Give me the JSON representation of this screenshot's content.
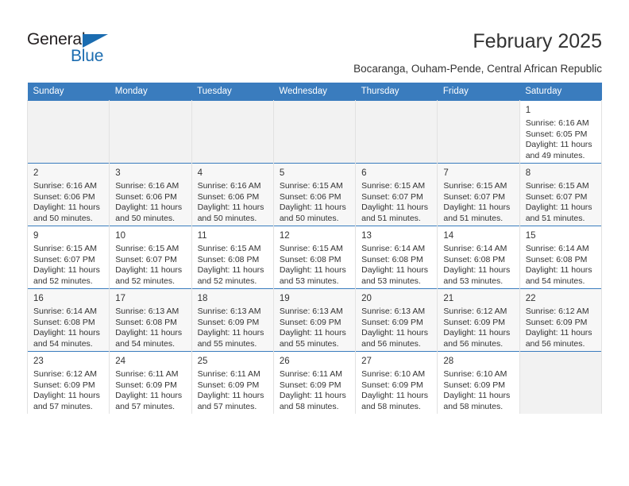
{
  "branding": {
    "logo_primary": "General",
    "logo_secondary": "Blue",
    "logo_icon": "blue-triangle-icon",
    "accent_color": "#1b6cb0"
  },
  "header": {
    "title": "February 2025",
    "subtitle": "Bocaranga, Ouham-Pende, Central African Republic"
  },
  "calendar": {
    "header_background": "#3a7cbe",
    "weekdays": [
      "Sunday",
      "Monday",
      "Tuesday",
      "Wednesday",
      "Thursday",
      "Friday",
      "Saturday"
    ],
    "weeks": [
      [
        {
          "day": "",
          "info": "",
          "empty": true
        },
        {
          "day": "",
          "info": "",
          "empty": true
        },
        {
          "day": "",
          "info": "",
          "empty": true
        },
        {
          "day": "",
          "info": "",
          "empty": true
        },
        {
          "day": "",
          "info": "",
          "empty": true
        },
        {
          "day": "",
          "info": "",
          "empty": true
        },
        {
          "day": "1",
          "info": "Sunrise: 6:16 AM\nSunset: 6:05 PM\nDaylight: 11 hours\nand 49 minutes.",
          "empty": false
        }
      ],
      [
        {
          "day": "2",
          "info": "Sunrise: 6:16 AM\nSunset: 6:06 PM\nDaylight: 11 hours\nand 50 minutes.",
          "empty": false
        },
        {
          "day": "3",
          "info": "Sunrise: 6:16 AM\nSunset: 6:06 PM\nDaylight: 11 hours\nand 50 minutes.",
          "empty": false
        },
        {
          "day": "4",
          "info": "Sunrise: 6:16 AM\nSunset: 6:06 PM\nDaylight: 11 hours\nand 50 minutes.",
          "empty": false
        },
        {
          "day": "5",
          "info": "Sunrise: 6:15 AM\nSunset: 6:06 PM\nDaylight: 11 hours\nand 50 minutes.",
          "empty": false
        },
        {
          "day": "6",
          "info": "Sunrise: 6:15 AM\nSunset: 6:07 PM\nDaylight: 11 hours\nand 51 minutes.",
          "empty": false
        },
        {
          "day": "7",
          "info": "Sunrise: 6:15 AM\nSunset: 6:07 PM\nDaylight: 11 hours\nand 51 minutes.",
          "empty": false
        },
        {
          "day": "8",
          "info": "Sunrise: 6:15 AM\nSunset: 6:07 PM\nDaylight: 11 hours\nand 51 minutes.",
          "empty": false
        }
      ],
      [
        {
          "day": "9",
          "info": "Sunrise: 6:15 AM\nSunset: 6:07 PM\nDaylight: 11 hours\nand 52 minutes.",
          "empty": false
        },
        {
          "day": "10",
          "info": "Sunrise: 6:15 AM\nSunset: 6:07 PM\nDaylight: 11 hours\nand 52 minutes.",
          "empty": false
        },
        {
          "day": "11",
          "info": "Sunrise: 6:15 AM\nSunset: 6:08 PM\nDaylight: 11 hours\nand 52 minutes.",
          "empty": false
        },
        {
          "day": "12",
          "info": "Sunrise: 6:15 AM\nSunset: 6:08 PM\nDaylight: 11 hours\nand 53 minutes.",
          "empty": false
        },
        {
          "day": "13",
          "info": "Sunrise: 6:14 AM\nSunset: 6:08 PM\nDaylight: 11 hours\nand 53 minutes.",
          "empty": false
        },
        {
          "day": "14",
          "info": "Sunrise: 6:14 AM\nSunset: 6:08 PM\nDaylight: 11 hours\nand 53 minutes.",
          "empty": false
        },
        {
          "day": "15",
          "info": "Sunrise: 6:14 AM\nSunset: 6:08 PM\nDaylight: 11 hours\nand 54 minutes.",
          "empty": false
        }
      ],
      [
        {
          "day": "16",
          "info": "Sunrise: 6:14 AM\nSunset: 6:08 PM\nDaylight: 11 hours\nand 54 minutes.",
          "empty": false
        },
        {
          "day": "17",
          "info": "Sunrise: 6:13 AM\nSunset: 6:08 PM\nDaylight: 11 hours\nand 54 minutes.",
          "empty": false
        },
        {
          "day": "18",
          "info": "Sunrise: 6:13 AM\nSunset: 6:09 PM\nDaylight: 11 hours\nand 55 minutes.",
          "empty": false
        },
        {
          "day": "19",
          "info": "Sunrise: 6:13 AM\nSunset: 6:09 PM\nDaylight: 11 hours\nand 55 minutes.",
          "empty": false
        },
        {
          "day": "20",
          "info": "Sunrise: 6:13 AM\nSunset: 6:09 PM\nDaylight: 11 hours\nand 56 minutes.",
          "empty": false
        },
        {
          "day": "21",
          "info": "Sunrise: 6:12 AM\nSunset: 6:09 PM\nDaylight: 11 hours\nand 56 minutes.",
          "empty": false
        },
        {
          "day": "22",
          "info": "Sunrise: 6:12 AM\nSunset: 6:09 PM\nDaylight: 11 hours\nand 56 minutes.",
          "empty": false
        }
      ],
      [
        {
          "day": "23",
          "info": "Sunrise: 6:12 AM\nSunset: 6:09 PM\nDaylight: 11 hours\nand 57 minutes.",
          "empty": false
        },
        {
          "day": "24",
          "info": "Sunrise: 6:11 AM\nSunset: 6:09 PM\nDaylight: 11 hours\nand 57 minutes.",
          "empty": false
        },
        {
          "day": "25",
          "info": "Sunrise: 6:11 AM\nSunset: 6:09 PM\nDaylight: 11 hours\nand 57 minutes.",
          "empty": false
        },
        {
          "day": "26",
          "info": "Sunrise: 6:11 AM\nSunset: 6:09 PM\nDaylight: 11 hours\nand 58 minutes.",
          "empty": false
        },
        {
          "day": "27",
          "info": "Sunrise: 6:10 AM\nSunset: 6:09 PM\nDaylight: 11 hours\nand 58 minutes.",
          "empty": false
        },
        {
          "day": "28",
          "info": "Sunrise: 6:10 AM\nSunset: 6:09 PM\nDaylight: 11 hours\nand 58 minutes.",
          "empty": false
        },
        {
          "day": "",
          "info": "",
          "empty": true
        }
      ]
    ]
  }
}
